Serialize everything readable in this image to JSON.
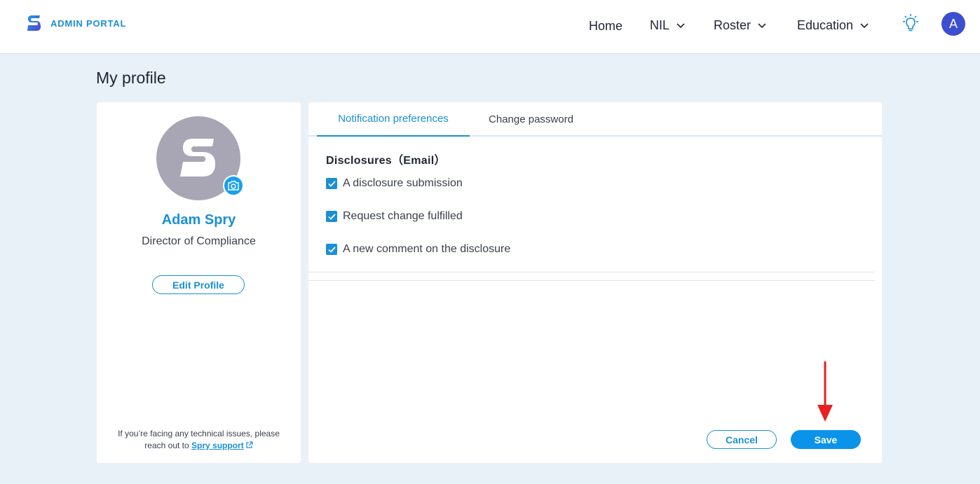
{
  "header": {
    "brand_text": "ADMIN PORTAL",
    "nav": {
      "home": "Home",
      "nil": "NIL",
      "roster": "Roster",
      "education": "Education"
    },
    "avatar_initial": "A",
    "icons": [
      "spry-logo-icon",
      "chevron-down-icon",
      "lightbulb-icon"
    ]
  },
  "page": {
    "title": "My profile"
  },
  "profile": {
    "name": "Adam Spry",
    "role": "Director of Compliance",
    "edit_label": "Edit Profile",
    "support_text": "If you’re facing any technical issues, please reach out to",
    "support_link": "Spry support"
  },
  "tabs": [
    {
      "label": "Notification preferences",
      "active": true
    },
    {
      "label": "Change password",
      "active": false
    }
  ],
  "notifications": {
    "section_title": "Disclosures（Email）",
    "options": [
      {
        "label": "A disclosure submission",
        "checked": true
      },
      {
        "label": "Request change fulfilled",
        "checked": true
      },
      {
        "label": "A new comment on the disclosure",
        "checked": true
      }
    ]
  },
  "actions": {
    "cancel_label": "Cancel",
    "save_label": "Save"
  },
  "colors": {
    "accent": "#1a8fd6",
    "save": "#0a93e8",
    "avatar": "#3b4fcf",
    "background": "#e8f0f8",
    "annotation_arrow": "#e82020"
  }
}
